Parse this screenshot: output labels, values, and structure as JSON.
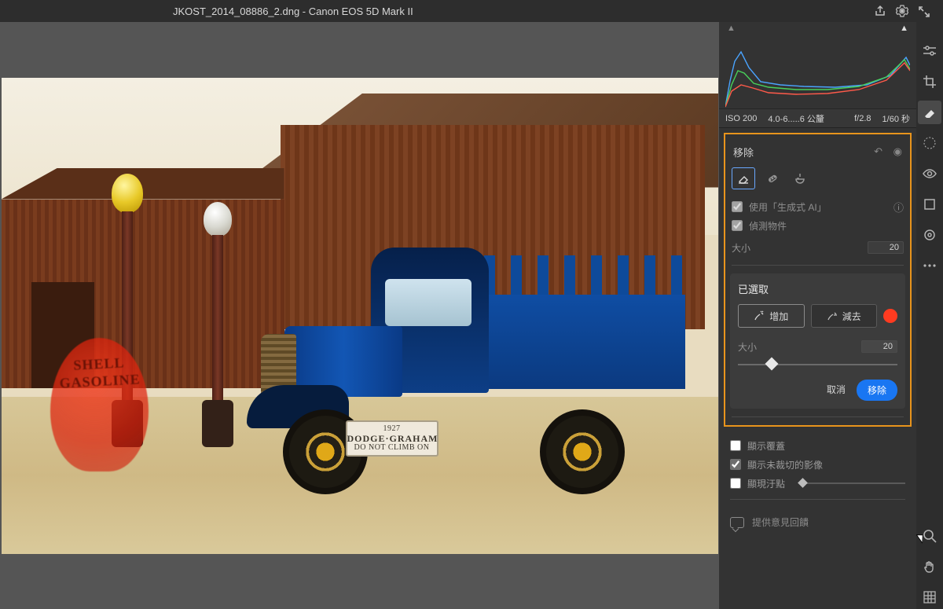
{
  "topbar": {
    "filename": "JKOST_2014_08886_2.dng",
    "separator": "  -  ",
    "camera": "Canon EOS 5D Mark II"
  },
  "histogram": {
    "iso": "ISO 200",
    "focal": "4.0-6.....6 公釐",
    "aperture": "f/2.8",
    "shutter": "1/60 秒"
  },
  "remove_panel": {
    "title": "移除",
    "use_gen_ai": "使用「生成式 AI」",
    "detect_objects": "偵測物件",
    "size_label": "大小",
    "size_value": "20",
    "selected_title": "已選取",
    "add_label": "增加",
    "subtract_label": "減去",
    "sel_size_label": "大小",
    "sel_size_value": "20",
    "cancel": "取消",
    "apply": "移除",
    "show_overlay": "顯示覆蓋",
    "show_uncropped": "顯示未裁切的影像",
    "show_spots": "顯現汙點",
    "feedback": "提供意見回饋"
  }
}
